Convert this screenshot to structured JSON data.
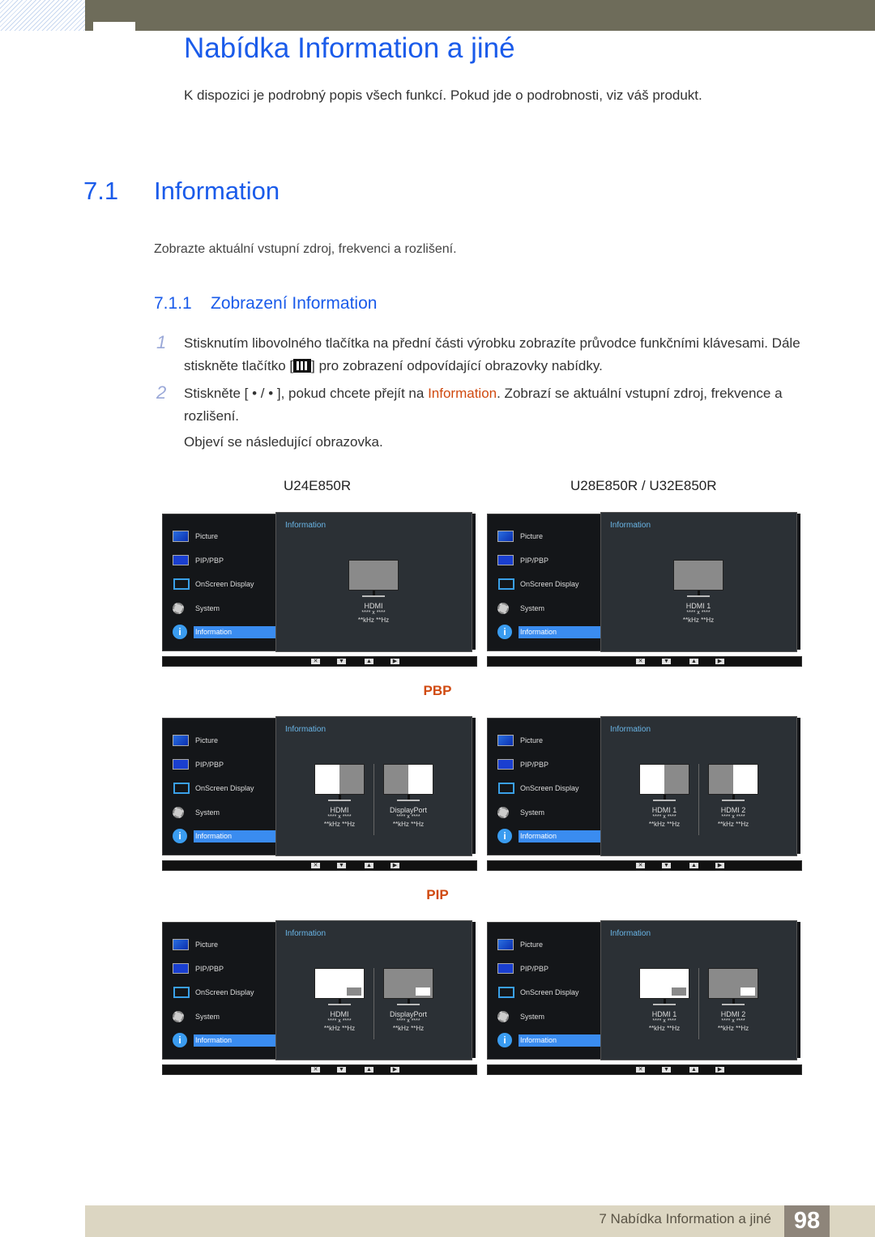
{
  "header": {
    "title": "Nabídka Information a jiné",
    "intro": "K dispozici je podrobný popis všech funkcí. Pokud jde o podrobnosti, viz váš produkt."
  },
  "section": {
    "number": "7.1",
    "title": "Information",
    "text": "Zobrazte aktuální vstupní zdroj, frekvenci a rozlišení."
  },
  "subsection": {
    "number": "7.1.1",
    "title": "Zobrazení Information"
  },
  "steps": [
    {
      "num": "1",
      "text_a": "Stisknutím libovolného tlačítka na přední části výrobku zobrazíte průvodce funkčními klávesami. Dále stiskněte tlačítko [",
      "text_b": "] pro zobrazení odpovídající obrazovky nabídky."
    },
    {
      "num": "2",
      "text_a": "Stiskněte [ • / • ], pokud chcete přejít na ",
      "highlight": "Information",
      "text_b": ". Zobrazí se aktuální vstupní zdroj, frekvence a rozlišení."
    }
  ],
  "note": "Objeví se následující obrazovka.",
  "models": {
    "left": "U24E850R",
    "right": "U28E850R / U32E850R"
  },
  "modes": {
    "pbp": "PBP",
    "pip": "PIP"
  },
  "osd": {
    "menu": [
      "Picture",
      "PIP/PBP",
      "OnScreen Display",
      "System",
      "Information"
    ],
    "panel_title": "Information",
    "res": "**** x ****",
    "freq": "**kHz **Hz",
    "sources": {
      "left_single": "HDMI",
      "right_single": "HDMI 1",
      "left_dual": [
        "HDMI",
        "DisplayPort"
      ],
      "right_dual": [
        "HDMI 1",
        "HDMI 2"
      ]
    },
    "keys": [
      "✕",
      "▼",
      "▲",
      "▶"
    ]
  },
  "footer": {
    "text": "7 Nabídka Information a jiné",
    "page": "98"
  }
}
